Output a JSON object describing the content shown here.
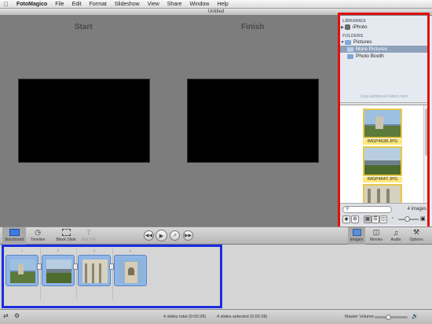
{
  "menu": {
    "app": "FotoMagico",
    "items": [
      "File",
      "Edit",
      "Format",
      "Slideshow",
      "View",
      "Share",
      "Window",
      "Help"
    ]
  },
  "window": {
    "title": "Untitled"
  },
  "stage": {
    "start_label": "Start",
    "finish_label": "Finish"
  },
  "browser": {
    "libraries_header": "LIBRARIES",
    "library_item": "iPhoto",
    "folders_header": "FOLDERS",
    "folders": [
      "Pictures",
      "More Pictures",
      "Photo Booth"
    ],
    "drag_hint": "Drag additional folders here",
    "thumbnails": [
      "IMGP4638.JPG",
      "IMGP4647.JPG"
    ],
    "count": "4 images"
  },
  "toolbar": {
    "left": [
      "Storyboard",
      "Timeline",
      "Blank Slide",
      "Add Title"
    ],
    "right": [
      "Images",
      "Movies",
      "Audio",
      "Options"
    ]
  },
  "storyboard": {
    "slide_numbers": [
      "1",
      "2",
      "3",
      "4"
    ]
  },
  "status": {
    "total": "4 slides total (0:00:28)",
    "selected": "4 slides selected (0:00:28)",
    "volume_label": "Master Volume:"
  },
  "colors": {
    "accent_blue": "#8fb6e6",
    "highlight_red": "#e01010",
    "highlight_blue": "#1a2ee0",
    "thumb_yellow": "#ffe77a"
  }
}
